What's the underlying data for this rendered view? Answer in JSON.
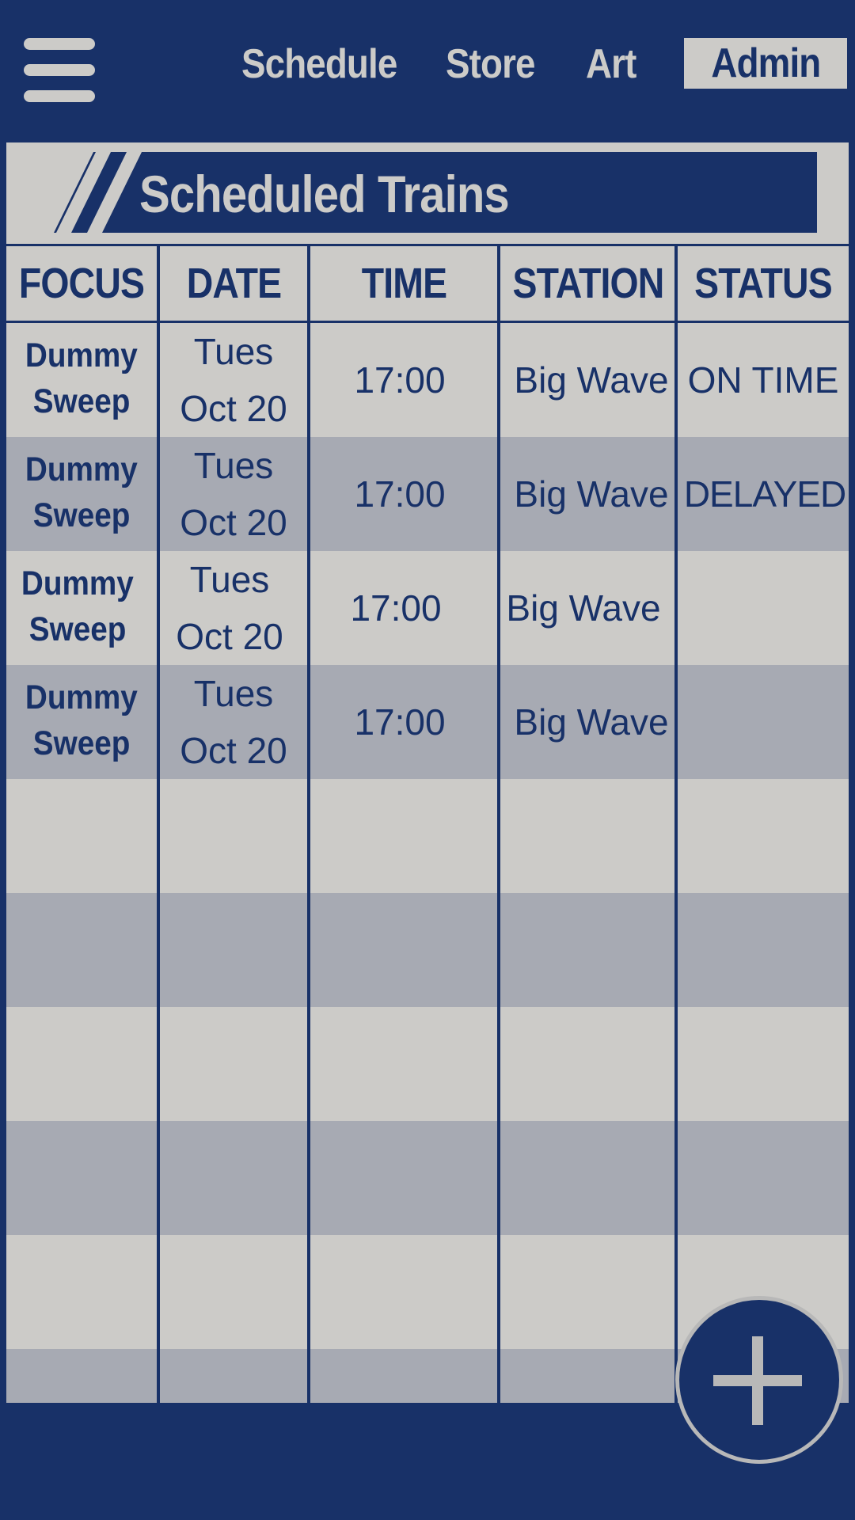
{
  "nav": {
    "links": [
      "Schedule",
      "Store",
      "Art"
    ],
    "admin_label": "Admin"
  },
  "title": "Scheduled Trains",
  "table": {
    "headers": [
      "FOCUS",
      "DATE",
      "TIME",
      "STATION",
      "STATUS"
    ],
    "rows": [
      {
        "focus_line1": "Dummy",
        "focus_line2": "Sweep",
        "date_line1": "Tues",
        "date_line2": "Oct 20",
        "time": "17:00",
        "station": "Big Wave",
        "status": "ON TIME"
      },
      {
        "focus_line1": "Dummy",
        "focus_line2": "Sweep",
        "date_line1": "Tues",
        "date_line2": "Oct 20",
        "time": "17:00",
        "station": "Big Wave",
        "status": "DELAYED"
      },
      {
        "focus_line1": "Dummy",
        "focus_line2": "Sweep",
        "date_line1": "Tues",
        "date_line2": "Oct 20",
        "time": "17:00",
        "station": "Big Wave",
        "status": ""
      },
      {
        "focus_line1": "Dummy",
        "focus_line2": "Sweep",
        "date_line1": "Tues",
        "date_line2": "Oct 20",
        "time": "17:00",
        "station": "Big Wave",
        "status": ""
      }
    ]
  },
  "icons": {
    "menu": "hamburger-menu-icon",
    "add": "plus-icon"
  },
  "colors": {
    "background": "#183168",
    "panel_light": "#cccbc8",
    "row_dark": "#a7aab3",
    "text_dark": "#183168"
  }
}
